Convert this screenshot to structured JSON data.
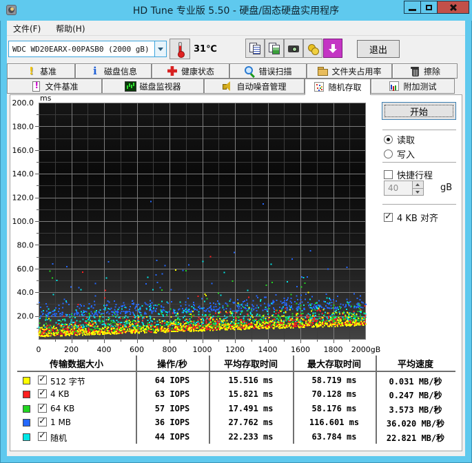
{
  "window": {
    "title": "HD Tune 专业版 5.50 - 硬盘/固态硬盘实用程序"
  },
  "colors": {
    "titlebar": "#5fc9ee",
    "close_button": "#c25049",
    "update_button": "#c435c4",
    "chart_bg_top": "#141414",
    "chart_bg_bottom": "#434343"
  },
  "menu": {
    "items": [
      "文件(F)",
      "帮助(H)"
    ]
  },
  "toolbar": {
    "drive": "WDC WD20EARX-00PASB0 (2000 gB)",
    "temperature": "31℃",
    "buttons": [
      "copy-text",
      "copy-image",
      "screenshot",
      "options",
      "update"
    ],
    "exit_label": "退出"
  },
  "tabs": {
    "selected": "随机存取",
    "row1": [
      {
        "label": "基准",
        "icon": "benchmark"
      },
      {
        "label": "磁盘信息",
        "icon": "disk-info"
      },
      {
        "label": "健康状态",
        "icon": "health"
      },
      {
        "label": "错误扫描",
        "icon": "error-scan"
      },
      {
        "label": "文件夹占用率",
        "icon": "folder-usage"
      },
      {
        "label": "擦除",
        "icon": "erase"
      }
    ],
    "row2": [
      {
        "label": "文件基准",
        "icon": "file-benchmark"
      },
      {
        "label": "磁盘监视器",
        "icon": "disk-monitor"
      },
      {
        "label": "自动噪音管理",
        "icon": "noise-management"
      },
      {
        "label": "随机存取",
        "icon": "random-access",
        "selected": true
      },
      {
        "label": "附加测试",
        "icon": "extra-tests"
      }
    ]
  },
  "panel": {
    "start_label": "开始",
    "read_label": "读取",
    "read_selected": true,
    "write_label": "写入",
    "short_stroke_label": "快捷行程",
    "short_stroke_checked": false,
    "short_stroke_value": "40",
    "short_stroke_unit": "gB",
    "align_label": "4 KB 对齐",
    "align_checked": true
  },
  "table": {
    "headers": [
      "传输数据大小",
      "操作/秒",
      "平均存取时间",
      "最大存取时间",
      "平均速度"
    ],
    "rows": [
      {
        "color": "#ffff00",
        "checked": true,
        "label": "512 字节",
        "iops": "64 IOPS",
        "avg": "15.516 ms",
        "max": "58.719 ms",
        "speed": "0.031 MB/秒"
      },
      {
        "color": "#ff2020",
        "checked": true,
        "label": "4 KB",
        "iops": "63 IOPS",
        "avg": "15.821 ms",
        "max": "70.128 ms",
        "speed": "0.247 MB/秒"
      },
      {
        "color": "#22d622",
        "checked": true,
        "label": "64 KB",
        "iops": "57 IOPS",
        "avg": "17.491 ms",
        "max": "58.176 ms",
        "speed": "3.573 MB/秒"
      },
      {
        "color": "#2468ff",
        "checked": true,
        "label": "1 MB",
        "iops": "36 IOPS",
        "avg": "27.762 ms",
        "max": "116.601 ms",
        "speed": "36.020 MB/秒"
      },
      {
        "color": "#00e6e6",
        "checked": true,
        "label": "随机",
        "iops": "44 IOPS",
        "avg": "22.233 ms",
        "max": "63.784 ms",
        "speed": "22.821 MB/秒"
      }
    ]
  },
  "chart_data": {
    "type": "scatter",
    "y_axis_label": "ms",
    "xlim": [
      0,
      2000
    ],
    "ylim": [
      0,
      200
    ],
    "x_ticks": [
      0,
      200,
      400,
      600,
      800,
      1000,
      1200,
      1400,
      1600,
      1800,
      2000
    ],
    "x_tick_labels": [
      "0",
      "200",
      "400",
      "600",
      "800",
      "1000",
      "1200",
      "1400",
      "1600",
      "1800",
      "2000gB"
    ],
    "y_ticks": [
      200,
      180,
      160,
      140,
      120,
      100,
      80,
      60,
      40,
      20
    ],
    "y_tick_labels": [
      "200.0",
      "180.0",
      "160.0",
      "140.0",
      "120.0",
      "100.0",
      "80.0",
      "60.0",
      "40.0",
      "20.0"
    ],
    "grid": {
      "x_major": 200,
      "x_minor": 100,
      "y_major": 20,
      "y_minor": 10
    },
    "colors": {
      "grid_major": "#7e7e7e",
      "grid_minor": "#3c3c3c"
    },
    "legend_position": "table-below",
    "draw_order": [
      3,
      4,
      2,
      1,
      0
    ],
    "series": [
      {
        "name": "512 字节",
        "color": "#ffff00",
        "iops": 64,
        "avg_ms": 15.516,
        "max_ms": 58.719,
        "avg_speed_mb_s": 0.031,
        "render": {
          "count": 780,
          "seed": 11,
          "b0": 2.5,
          "b1": 12,
          "scale": 3.8,
          "cap": 16,
          "out_prob": 0.008,
          "out_min": 16,
          "out_max": 34,
          "max_point": [
            838,
            58.7
          ]
        }
      },
      {
        "name": "4 KB",
        "color": "#ff2020",
        "iops": 63,
        "avg_ms": 15.821,
        "max_ms": 70.128,
        "avg_speed_mb_s": 0.247,
        "render": {
          "count": 720,
          "seed": 22,
          "b0": 3,
          "b1": 13,
          "scale": 3.8,
          "cap": 16,
          "out_prob": 0.01,
          "out_min": 16,
          "out_max": 38,
          "extra_points": [
            [
              270,
              57
            ],
            [
              408,
              41.5
            ]
          ],
          "max_point": [
            1050,
            70.1
          ]
        }
      },
      {
        "name": "64 KB",
        "color": "#22d622",
        "iops": 57,
        "avg_ms": 17.491,
        "max_ms": 58.176,
        "avg_speed_mb_s": 3.573,
        "render": {
          "count": 720,
          "seed": 33,
          "b0": 4,
          "b1": 14.5,
          "scale": 4.2,
          "cap": 18,
          "out_prob": 0.015,
          "out_min": 18,
          "out_max": 42,
          "extra_points": [
            [
              70,
              57.8
            ],
            [
              84,
              52
            ]
          ],
          "max_point": [
            900,
            58.2
          ]
        }
      },
      {
        "name": "1 MB",
        "color": "#2468ff",
        "iops": 36,
        "avg_ms": 27.762,
        "max_ms": 116.601,
        "avg_speed_mb_s": 36.02,
        "render": {
          "count": 520,
          "seed": 44,
          "b0": 19,
          "b1": 27,
          "scale": 4.5,
          "cap": 13,
          "out_prob": 0.05,
          "out_min": 13,
          "out_max": 46,
          "extra_points": [
            [
              1372,
              114.5
            ],
            [
              1195,
              73.5
            ],
            [
              1660,
              75
            ]
          ],
          "max_point": [
            686,
            116.6
          ]
        }
      },
      {
        "name": "随机",
        "color": "#00e6e6",
        "iops": 44,
        "avg_ms": 22.233,
        "max_ms": 63.784,
        "avg_speed_mb_s": 22.821,
        "render": {
          "count": 520,
          "seed": 55,
          "b0": 9,
          "b1": 16.5,
          "scale": 6,
          "cap": 20,
          "out_prob": 0.03,
          "out_min": 20,
          "out_max": 44,
          "extra_points": [
            [
              1005,
              66
            ]
          ],
          "max_point": [
            1420,
            63.8
          ]
        }
      }
    ]
  }
}
